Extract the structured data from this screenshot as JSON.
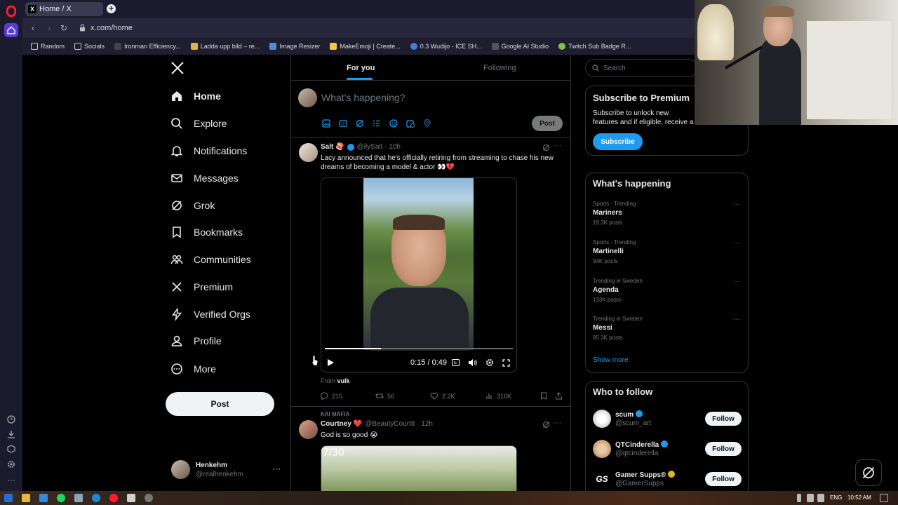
{
  "browser": {
    "tab_title": "Home / X",
    "url": "x.com/home",
    "bookmarks": [
      "Random",
      "Socials",
      "Ironman Efficiency...",
      "Ladda upp bild – re...",
      "Image Resizer",
      "MakeEmoji | Create...",
      "0.3 Wudijo - ICE SH...",
      "Google AI Studio",
      "Twitch Sub Badge R..."
    ]
  },
  "nav": {
    "items": [
      {
        "label": "Home",
        "icon": "home-icon"
      },
      {
        "label": "Explore",
        "icon": "search-icon"
      },
      {
        "label": "Notifications",
        "icon": "bell-icon"
      },
      {
        "label": "Messages",
        "icon": "envelope-icon"
      },
      {
        "label": "Grok",
        "icon": "grok-icon"
      },
      {
        "label": "Bookmarks",
        "icon": "bookmark-icon"
      },
      {
        "label": "Communities",
        "icon": "people-icon"
      },
      {
        "label": "Premium",
        "icon": "x-icon"
      },
      {
        "label": "Verified Orgs",
        "icon": "lightning-icon"
      },
      {
        "label": "Profile",
        "icon": "person-icon"
      },
      {
        "label": "More",
        "icon": "more-circle-icon"
      }
    ],
    "post_label": "Post",
    "account": {
      "name": "Henkehm",
      "handle": "@realhenkehm",
      "menu": "···"
    }
  },
  "feed": {
    "tabs": [
      "For you",
      "Following"
    ],
    "composer_placeholder": "What's happening?",
    "composer_post": "Post",
    "tweet1": {
      "name": "Salt 🍣",
      "handle": "@ilySalt · 10h",
      "text": "Lacy announced that he's officially retiring from streaming to chase his new dreams of becoming a model & actor 👀💔",
      "video_time": "0:15 / 0:49",
      "video_progress": 0.3,
      "from_prefix": "From ",
      "from_user": "vulk",
      "replies": "215",
      "reposts": "56",
      "likes": "2.2K",
      "views": "316K"
    },
    "tweet2": {
      "social_context": "KAI MAFIA",
      "name": "Courtney ❤️",
      "handle": "@BeautyCourttt · 12h",
      "text": "God is so good 😭",
      "image_overlay": "7/30"
    }
  },
  "sidebar": {
    "search_placeholder": "Search",
    "premium": {
      "title": "Subscribe to Premium",
      "body": "Subscribe to unlock new features and if eligible, receive a share of revenue.",
      "button": "Subscribe"
    },
    "whats_happening": {
      "title": "What's happening",
      "trends": [
        {
          "context": "Sports · Trending",
          "name": "Mariners",
          "count": "19.3K posts"
        },
        {
          "context": "Sports · Trending",
          "name": "Martinelli",
          "count": "94K posts"
        },
        {
          "context": "Trending in Sweden",
          "name": "Agenda",
          "count": "133K posts"
        },
        {
          "context": "Trending in Sweden",
          "name": "Messi",
          "count": "85.3K posts"
        }
      ],
      "show_more": "Show more"
    },
    "who_to_follow": {
      "title": "Who to follow",
      "users": [
        {
          "name": "scum",
          "handle": "@scum_art"
        },
        {
          "name": "QTCinderella",
          "handle": "@qtcinderella"
        },
        {
          "name": "Gamer Supps®",
          "handle": "@GamerSupps"
        }
      ],
      "follow_label": "Follow"
    }
  },
  "taskbar": {
    "lang": "ENG",
    "clock": "10:52 AM"
  },
  "colors": {
    "accent": "#1d9bf0",
    "bg": "#000000",
    "muted": "#71767b",
    "border": "#2f3336"
  }
}
